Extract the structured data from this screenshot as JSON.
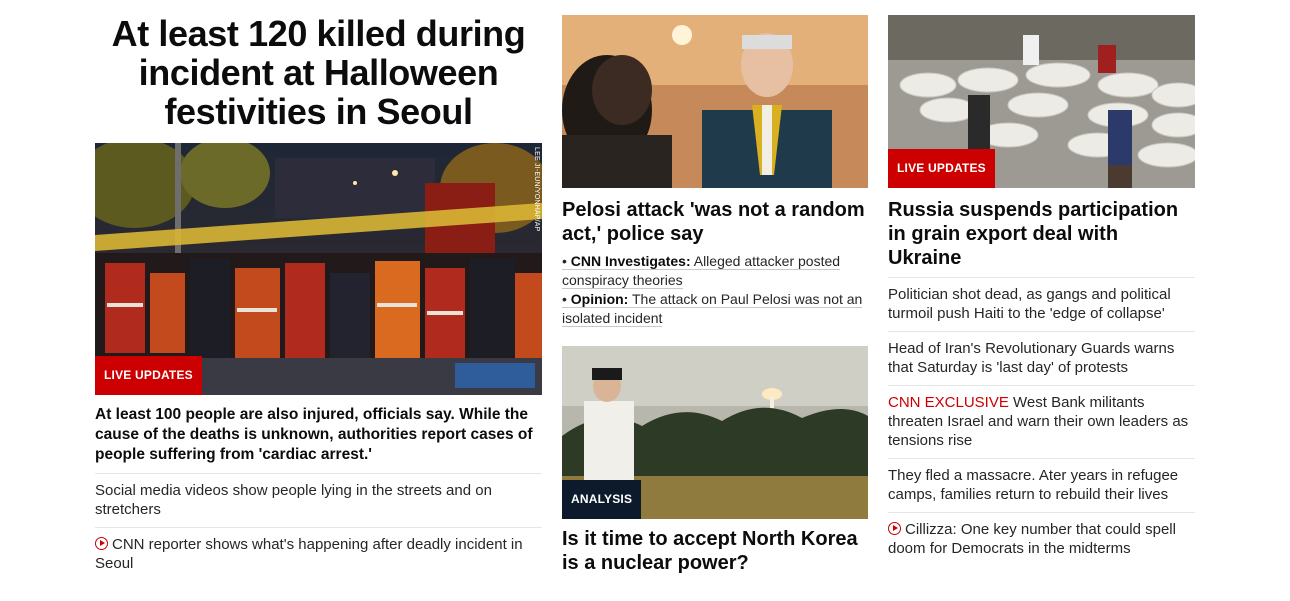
{
  "col1": {
    "main_headline": "At least 120 killed during incident at Halloween festivities in Seoul",
    "photo_credit": "LEE JI-EUN/YONHAP/AP",
    "badge": "LIVE UPDATES",
    "description": "At least 100 people are also injured, officials say. While the cause of the deaths is unknown, authorities report cases of people suffering from 'cardiac arrest.'",
    "links": [
      {
        "text": "Social media videos show people lying in the streets and on stretchers"
      },
      {
        "icon": "play-icon",
        "text": "CNN reporter shows what's happening after deadly incident in Seoul"
      }
    ]
  },
  "col2": {
    "story1": {
      "headline": "Pelosi attack 'was not a random act,' police say",
      "sublinks": [
        {
          "label": "CNN Investigates:",
          "text": "Alleged attacker posted conspiracy theories"
        },
        {
          "label": "Opinion:",
          "text": "The attack on Paul Pelosi was not an isolated incident"
        }
      ]
    },
    "story2": {
      "badge": "ANALYSIS",
      "headline": "Is it time to accept North Korea is a nuclear power?"
    }
  },
  "col3": {
    "badge": "LIVE UPDATES",
    "headline": "Russia suspends participation in grain export deal with Ukraine",
    "links": [
      {
        "text": "Politician shot dead, as gangs and political turmoil push Haiti to the 'edge of collapse'"
      },
      {
        "text": "Head of Iran's Revolutionary Guards warns that Saturday is 'last day' of protests"
      },
      {
        "prefix": "CNN EXCLUSIVE",
        "text": "West Bank militants threaten Israel and warn their own leaders as tensions rise"
      },
      {
        "text": "They fled a massacre. Ater years in refugee camps, families return to rebuild their lives"
      },
      {
        "icon": "play-icon",
        "text": "Cillizza: One key number that could spell doom for Democrats in the midterms"
      }
    ]
  },
  "colors": {
    "accent_red": "#cc0000",
    "analysis_badge": "#0c1a2b"
  }
}
